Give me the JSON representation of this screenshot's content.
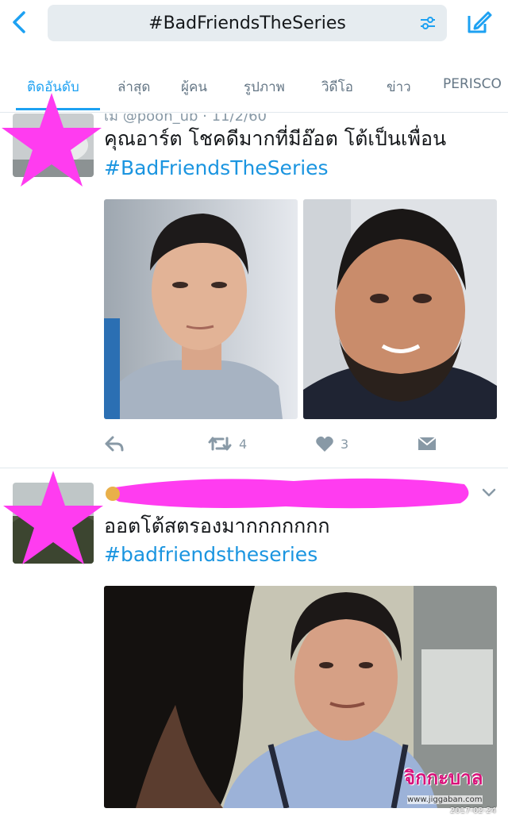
{
  "search": {
    "query": "#BadFriendsTheSeries"
  },
  "tabs": [
    {
      "label": "ติดอันดับ"
    },
    {
      "label": "ล่าสุด"
    },
    {
      "label": "ผู้คน"
    },
    {
      "label": "รูปภาพ"
    },
    {
      "label": "วิดีโอ"
    },
    {
      "label": "ข่าว"
    },
    {
      "label": "PERISCO"
    }
  ],
  "tweets": [
    {
      "header_partial": "เม @pooh_ub · 11/2/60",
      "text": "คุณอาร์ต โชคดีมากที่มีอ๊อต โต้เป็นเพื่อน",
      "hashtag": "#BadFriendsTheSeries",
      "retweets": "4",
      "likes": "3"
    },
    {
      "text": "ออตโต้สตรองมากกกกกกก",
      "hashtag": "#badfriendstheseries"
    }
  ],
  "watermark": {
    "title": "จิกกะบาล",
    "url": "www.jiggaban.com",
    "date": "2017-02-24"
  },
  "colors": {
    "accent": "#1da1f2",
    "hashtag": "#1b95e0",
    "star": "#ff3cf0",
    "scribble": "#ff3cf0"
  },
  "icons": [
    "back-icon",
    "filter-icon",
    "compose-icon",
    "reply-icon",
    "retweet-icon",
    "like-icon",
    "dm-icon",
    "chevron-down-icon"
  ]
}
